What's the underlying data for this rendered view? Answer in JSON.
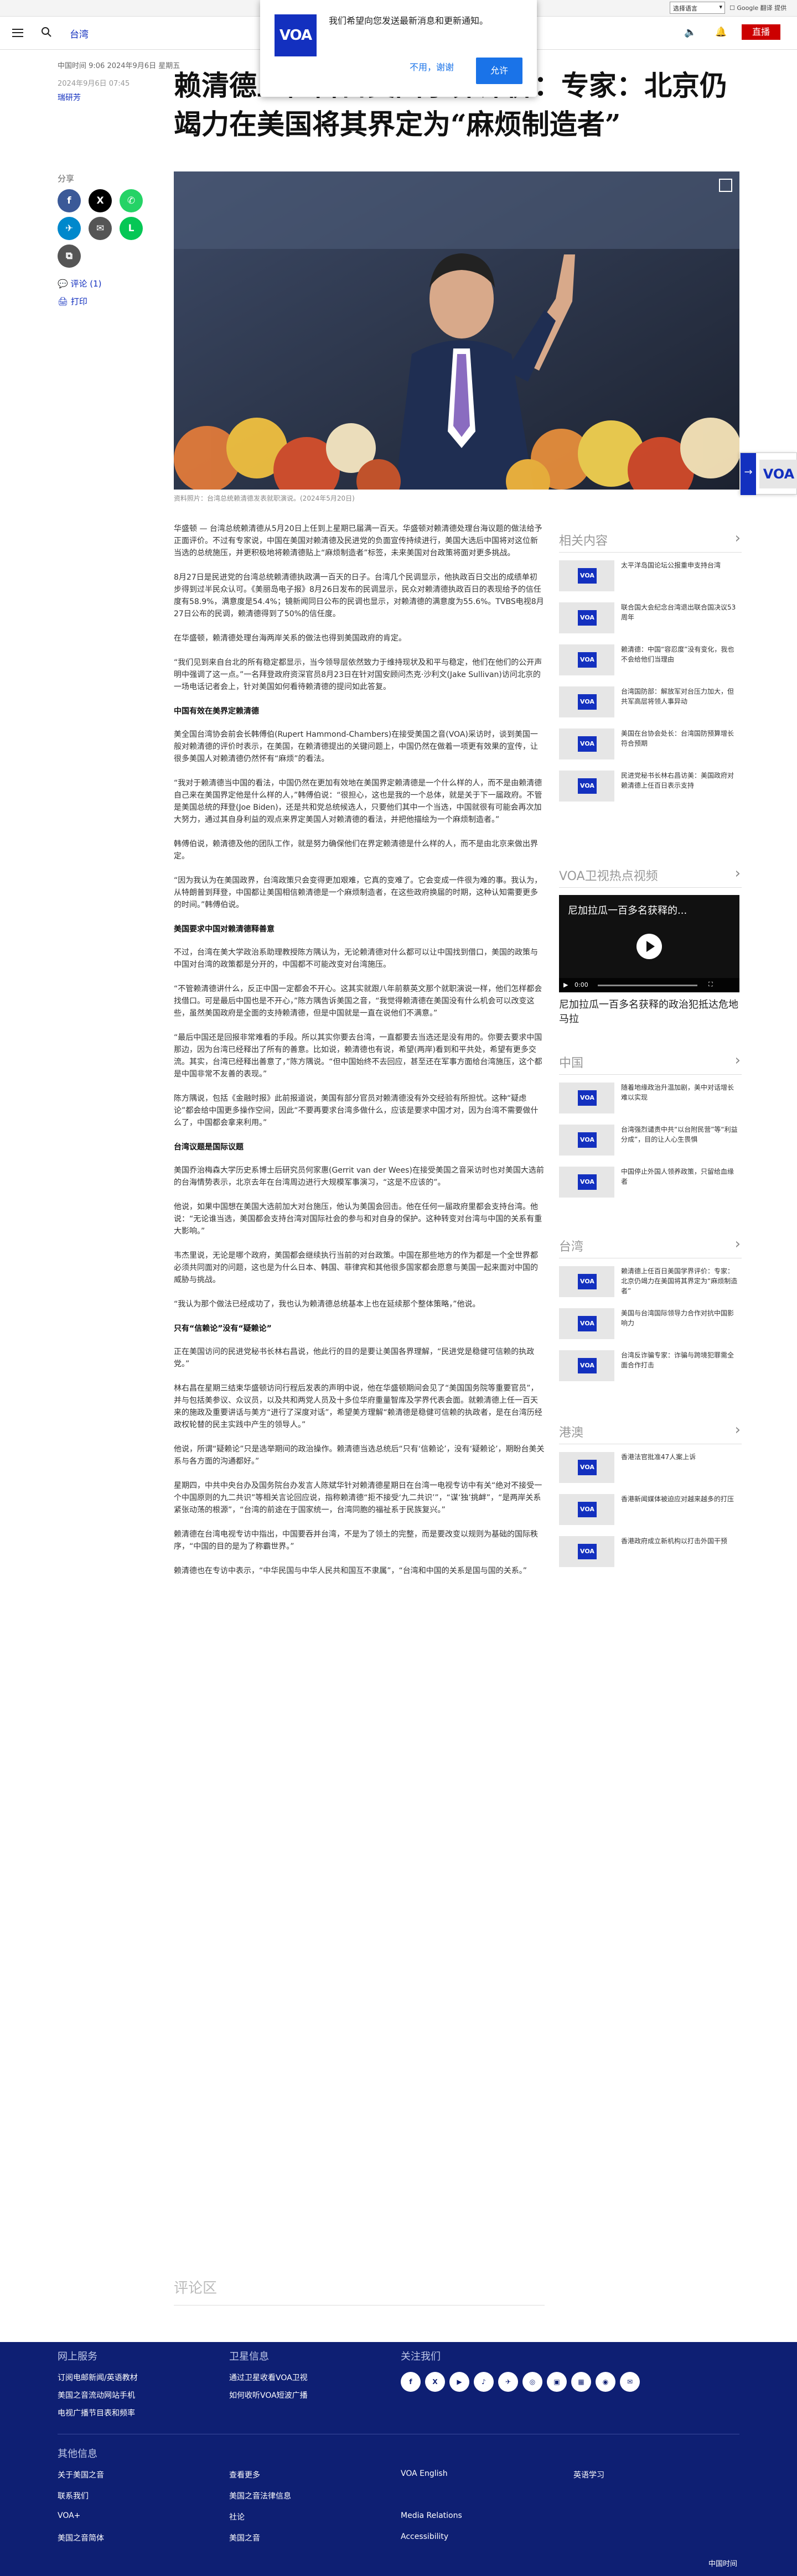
{
  "util": {
    "language": "选择语言",
    "links": "☐ Google 翻译 提供"
  },
  "header": {
    "section": "台湾",
    "live": "直播"
  },
  "popup": {
    "logo": "VOA",
    "message": "我们希望向您发送最新消息和更新通知。",
    "deny": "不用，谢谢",
    "allow": "允许"
  },
  "article": {
    "meta_updated": "中国时间 9:06 2024年9月6日 星期五",
    "meta_date": "2024年9月6日 07:45",
    "author": "瑞研芳",
    "title": "赖清德上任百日美国学界评价：专家：北京仍竭力在美国将其界定为“麻烦制造者”",
    "share_label": "分享",
    "comments": "评论 (1)",
    "print": "打印",
    "caption": "资料照片：台湾总统赖清德发表就职演说。(2024年5月20日)",
    "paragraphs": [
      "华盛顿 — 台湾总统赖清德从5月20日上任到上星期已届满一百天。华盛顿对赖清德处理台海议题的做法给予正面评价。不过有专家说，中国在美国对赖清德及民进党的负面宣传持续进行，美国大选后中国将对这位新当选的总统施压，并更积极地将赖清德贴上“麻烦制造者”标签，未来美国对台政策将面对更多挑战。",
      "8月27日是民进党的台湾总统赖清德执政满一百天的日子。台湾几个民调显示，他执政百日交出的成绩单初步得到过半民众认可。《美丽岛电子报》8月26日发布的民调显示，民众对赖清德执政百日的表现给予的信任度有58.9%，满意度是54.4%；镜新闻同日公布的民调也显示，对赖清德的满意度为55.6%。TVBS电视8月27日公布的民调，赖清德得到了50%的信任度。",
      "在华盛顿，赖清德处理台海两岸关系的做法也得到美国政府的肯定。",
      "“我们见到来自台北的所有稳定都显示，当今领导层依然致力于维持现状及和平与稳定，他们在他们的公开声明中强调了这一点。”一名拜登政府资深官员8月23日在针对国安顾问杰克·沙利文(Jake Sullivan)访问北京的一场电话记者会上，针对美国如何看待赖清德的提问如此答复。"
    ],
    "h1": "中国有效在美界定赖清德",
    "paragraphs2": [
      "美全国台湾协会前会长韩傅伯(Rupert Hammond-Chambers)在接受美国之音(VOA)采访时，谈到美国一般对赖清德的评价时表示，在美国，在赖清德提出的关键问题上，中国仍然在做着一项更有效果的宣传，让很多美国人对赖清德仍然怀有“麻烦”的看法。",
      "“我对于赖清德当中国的看法，中国仍然在更加有效地在美国界定赖清德是一个什么样的人，而不是由赖清德自己来在美国界定他是什么样的人，”韩傅伯说：“很担心，这也是我的一个总体，就是关于下一届政府。不管是美国总统的拜登(Joe Biden)，还是共和党总统候选人，只要他们其中一个当选，中国就很有可能会再次加大努力，通过其自身利益的观点来界定美国人对赖清德的看法，并把他描绘为一个麻烦制造者。”",
      "韩傅伯说，赖清德及他的团队工作，就是努力确保他们在界定赖清德是什么样的人，而不是由北京来做出界定。",
      "“因为我认为在美国政界，台湾政策只会变得更加艰难，它真的变难了。它会变成一件很为难的事。我认为，从特朗普到拜登，中国都让美国相信赖清德是一个麻烦制造者，在这些政府换届的时期，这种认知需要更多的时间。”韩傅伯说。"
    ],
    "h2": "美国要求中国对赖清德释善意",
    "paragraphs3": [
      "不过，台湾在美大学政治系助理教授陈方隅认为，无论赖清德对什么都可以让中国找到借口，美国的政策与中国对台湾的政策都是分开的，中国都不可能改变对台湾施压。",
      "“不管赖清德讲什么，反正中国一定都会不开心。这其实就跟八年前蔡英文那个就职演说一样，他们怎样都会找借口。可是最后中国也是不开心，”陈方隅告诉美国之音，“我觉得赖清德在美国没有什么机会可以改变这些，虽然美国政府是全面的支持赖清德，但是中国就是一直在说他们不满意。”",
      "“最后中国还是回报非常难看的手段。所以其实你要去台湾，一直都要去当选还是没有用的。你要去要求中国那边，因为台湾已经释出了所有的善意。比如说，赖清德也有说，希望(两岸)看到和平共处，希望有更多交流。其实，台湾已经释出善意了，”陈方隅说。“但中国始终不去回应，甚至还在军事方面给台湾施压，这个都是中国非常不友善的表现。”",
      "陈方隅说，包括《金融时报》此前报道说，美国有部分官员对赖清德没有外交经验有所担忧。这种“疑虑论”都会给中国更多操作空间，因此“不要再要求台湾多做什么，应该是要求中国才对，因为台湾不需要做什么了，中国都会拿来利用。”"
    ],
    "h3": "台湾议题是国际议题",
    "paragraphs4": [
      "美国乔治梅森大学历史系博士后研究员何家惠(Gerrit van der Wees)在接受美国之音采访时也对美国大选前的台海情势表示，北京去年在台湾周边进行大规模军事演习，“这是不应该的”。",
      "他说，如果中国想在美国大选前加大对台施压，他认为美国会回击。他在任何一届政府里都会支持台湾。他说：“无论谁当选，美国都会支持台湾对国际社会的参与和对自身的保护。这种转变对台湾与中国的关系有重大影响。”",
      "韦杰里说，无论是哪个政府，美国都会继续执行当前的对台政策。中国在那些地方的作为都是一个全世界都必须共同面对的问题，这也是为什么日本、韩国、菲律宾和其他很多国家都会愿意与美国一起来面对中国的威胁与挑战。",
      "“我认为那个做法已经成功了，我也认为赖清德总统基本上也在延续那个整体策略，”他说。"
    ],
    "h4": "只有“信赖论”没有“疑赖论”",
    "paragraphs5": [
      "正在美国访问的民进党秘书长林右昌说，他此行的目的是要让美国各界理解，“民进党是稳健可信赖的执政党。”",
      "林右昌在星期三结束华盛顿访问行程后发表的声明中说，他在华盛顿期间会见了“美国国务院等重要官员”，并与包括美参议、众议员，以及共和两党人员及十多位华府重量智库及学界代表会面。就赖清德上任一百天来的施政及重要讲话与美方“进行了深度对话”，希望美方理解“赖清德是稳健可信赖的执政者，是在台湾历经政权轮替的民主实践中产生的领导人。”",
      "他说，所谓“疑赖论”只是选举期间的政治操作。赖清德当选总统后“只有‘信赖论’，没有‘疑赖论’，期盼台美关系与各方面的沟通都好。”",
      "星期四，中共中央台办及国务院台办发言人陈斌华针对赖清德星期日在台湾一电视专访中有关“绝对不接受一个中国原则的九二共识”等相关言论回应说，指称赖清德“拒不接受‘九二共识’”，“谋‘独’挑衅”，“是两岸关系紧张动荡的根源”，“台湾的前途在于国家统一，台湾同胞的福祉系于民族复兴。”",
      "赖清德在台湾电视专访中指出，中国要吞并台湾，不是为了领土的完整，而是要改变以规则为基础的国际秩序，“中国的目的是为了称霸世界。”",
      "赖清德也在专访中表示，“中华民国与中华人民共和国互不隶属”，“台湾和中国的关系是国与国的关系。”"
    ],
    "comments_head": "评论区"
  },
  "sidebar": {
    "related_title": "相关内容",
    "related": [
      "太平洋岛国论坛公报重申支持台湾",
      "联合国大会纪念台湾退出联合国决议53周年",
      "赖清德：中国“容忍度”没有变化，我也不会给他们当理由",
      "台湾国防部：解放军对台压力加大，但共军高层将领人事异动",
      "美国在台协会处长：台湾国防预算增长符合预期",
      "民进党秘书长林右昌访美：美国政府对赖清德上任百日表示支持"
    ],
    "video_title": "VOA卫视热点视频",
    "video_overlay": "尼加拉瓜一百多名获释的...",
    "video_time": "0:00",
    "video_caption": "尼加拉瓜一百多名获释的政治犯抵达危地马拉",
    "china_title": "中国",
    "china": [
      "随着地缘政治升温加剧，美中对话增长难以实现",
      "台湾强烈谴责中共“以台附民营”等“利益分成”，目的让人心生畏惧",
      "中国停止外国人领养政策，只留给血缘者"
    ],
    "taiwan_title": "台湾",
    "taiwan": [
      "赖清德上任百日美国学界评价：专家：北京仍竭力在美国将其界定为“麻烦制造者”",
      "美国与台湾国际领导力合作对抗中国影响力",
      "台湾反诈骗专家：诈骗与跨境犯罪需全面合作打击"
    ],
    "hk_title": "港澳",
    "hk": [
      "香港法官批准47人案上诉",
      "香港新闻媒体被迫应对越来越多的打压",
      "香港政府成立新机构以打击外国干预"
    ]
  },
  "footer": {
    "col1_title": "网上服务",
    "col1": [
      "订阅电邮新闻/英语教材",
      "美国之音流动网站手机",
      "电视广播节目表和频率"
    ],
    "col2_title": "卫星信息",
    "col2": [
      "通过卫星收看VOA卫视",
      "如何收听VOA短波广播"
    ],
    "col3_title": "关注我们",
    "social": [
      "f",
      "X",
      "▶",
      "♪",
      "✈",
      "◎",
      "▣",
      "▦",
      "◉",
      "✉"
    ],
    "other_title": "其他信息",
    "row1": [
      "关于美国之音",
      "查看更多",
      "VOA English",
      "英语学习"
    ],
    "row2": [
      "联系我们",
      "美国之音法律信息",
      "",
      ""
    ],
    "row3": [
      "VOA+",
      "社论",
      "Media Relations",
      ""
    ],
    "row4": [
      "美国之音简体",
      "美国之音",
      "Accessibility",
      ""
    ],
    "bottom": "中国时间"
  },
  "colors": {
    "brand": "#1330bf",
    "footer": "#0e1f73",
    "live": "#cc0000"
  }
}
